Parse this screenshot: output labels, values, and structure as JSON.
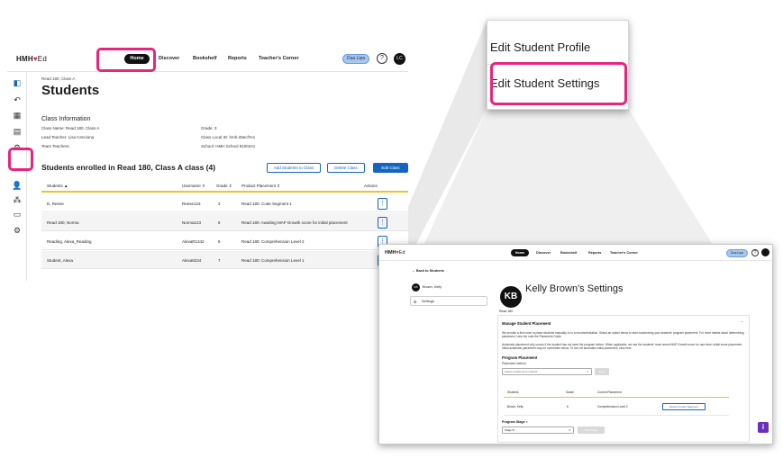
{
  "list_view": {
    "brand": {
      "hmh": "HMH",
      "ed": "Ed"
    },
    "nav": {
      "home": "Home",
      "discover": "Discover",
      "bookshelf": "Bookshelf",
      "reports": "Reports",
      "teachers_corner": "Teacher's Corner"
    },
    "dua_label": "Dua Lipa",
    "help": "?",
    "avatar_initials": "LC",
    "breadcrumb": "Read 180, Class A",
    "page_title": "Students",
    "class_info": {
      "heading": "Class Information",
      "class_name": "Class Name: Read 180, Class A",
      "lead_teacher": "Lead Teacher: Lisa Cenciona",
      "team_teachers": "Team Teachers:",
      "grade": "Grade: 3",
      "class_local_id": "Class Local ID: hmh-28ecf7e1",
      "school": "School: HMH School 9100241"
    },
    "enrolled_title": "Students enrolled in Read 180, Class A class (4)",
    "buttons": {
      "add": "Add Students to Class",
      "delete": "Delete Class",
      "edit": "Edit Class"
    },
    "columns": [
      "Students ▲",
      "Username ⇕",
      "Grade ⇕",
      "Product Placement ⇕",
      "Actions"
    ],
    "rows": [
      {
        "student": "D, Reese",
        "username": "Reese123",
        "grade": "3",
        "placement": "Read 180: Code Segment 1"
      },
      {
        "student": "Read 180, Norma",
        "username": "Norma123",
        "grade": "5",
        "placement": "Read 180: Awaiting MAP Growth score for initial placement"
      },
      {
        "student": "Reading, Alexa_Reading",
        "username": "AlexaR1342",
        "grade": "6",
        "placement": "Read 180: Comprehension Level 2"
      },
      {
        "student": "Student, Alexa",
        "username": "Alexa8234",
        "grade": "7",
        "placement": "Read 180: Comprehension Level 1"
      }
    ],
    "kebab": "⋮"
  },
  "callout": {
    "item1": "Edit Student Profile",
    "item2": "Edit Student Settings"
  },
  "settings_view": {
    "brand": {
      "hmh": "HMH",
      "ed": "Ed"
    },
    "nav": {
      "home": "Home",
      "discover": "Discover",
      "bookshelf": "Bookshelf",
      "reports": "Reports",
      "teachers_corner": "Teacher's Corner"
    },
    "dua_label": "Dua Lipa",
    "help": "?",
    "back_link": "← Back to Students",
    "student_name": "Brown, Kelly",
    "student_initials": "KB",
    "settings_nav": "Settings",
    "page_title": "Kelly Brown's Settings",
    "product": "Read 180",
    "manage_heading": "Manage Student Placement",
    "desc1": "We provide a first voice to place students manually or to a recommendation. Select an option below to start customizing your students' program placement. For more details about determining placement, view the note the Placement Guide",
    "desc2": "Automatic placement only occurs if the student has not used the program before. When applicable, we use the students' most recent MAP Growth score for user time; initial score placement. Initial automatic placement may be overridden below. To turn off automatic initial placement, click here",
    "program_heading": "Program Placement",
    "placement_method_label": "Placement method",
    "placement_method_placeholder": "Select a placement method",
    "apply_label": "Apply",
    "table_columns": [
      "Students",
      "Grade",
      "Current Placement"
    ],
    "table_row": {
      "student": "Brown, Kelly",
      "grade": "6",
      "placement": "Comprehension Level 2",
      "reset": "Reset Current Segment"
    },
    "stage_label": "Program Stage",
    "stage_value": "Stage B",
    "save_stage": "Save Stage",
    "info_icon": "i"
  }
}
